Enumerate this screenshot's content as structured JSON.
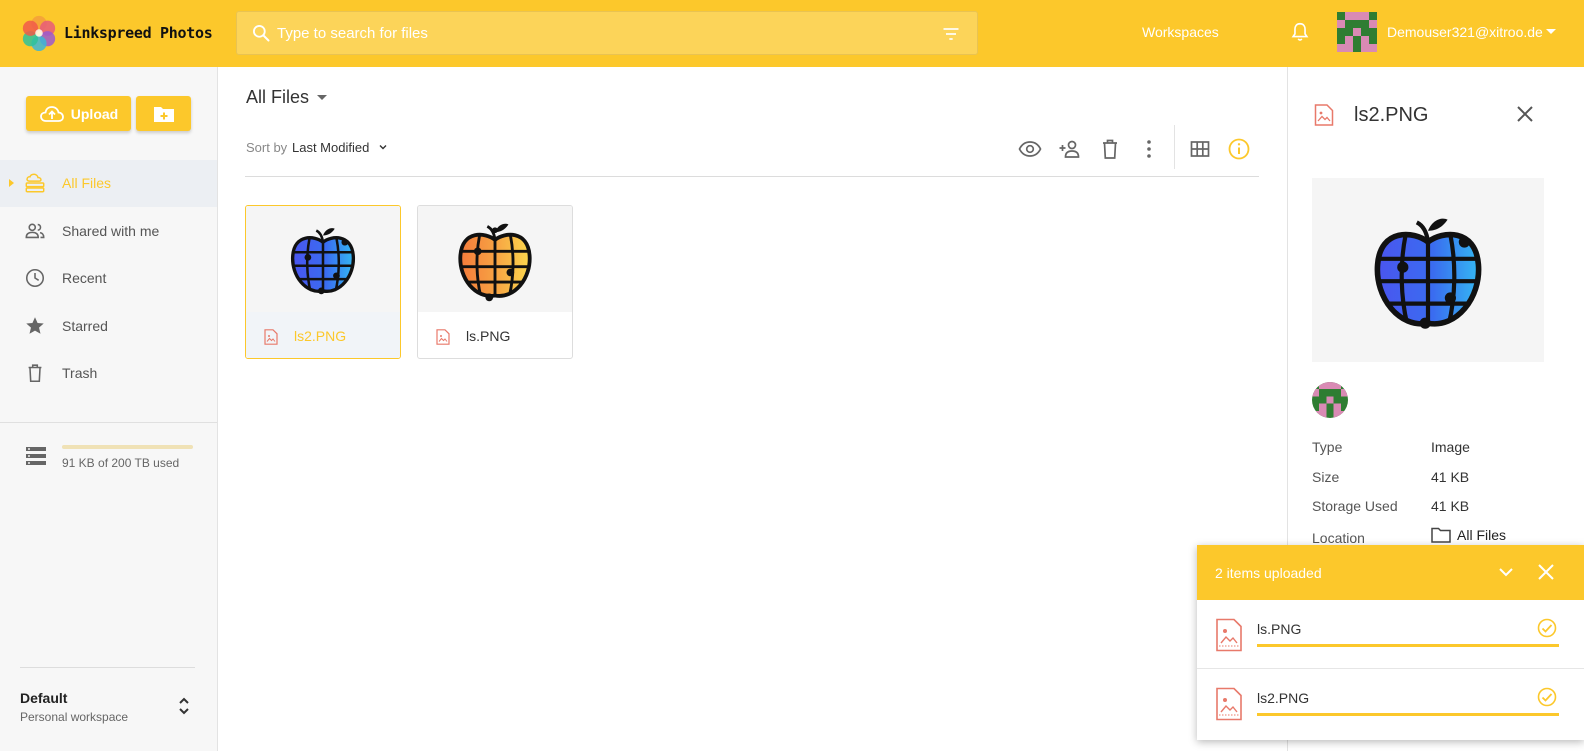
{
  "colors": {
    "accent": "#fcc82b",
    "file_icon": "#e8796a"
  },
  "header": {
    "app_name": "Linkspreed Photos",
    "search": {
      "placeholder": "Type to search for files"
    },
    "workspaces_label": "Workspaces",
    "user_email": "Demouser321@xitroo.de"
  },
  "sidebar": {
    "upload_label": "Upload",
    "nav": [
      {
        "label": "All Files",
        "icon": "cloud-stack-icon",
        "active": true
      },
      {
        "label": "Shared with me",
        "icon": "people-icon"
      },
      {
        "label": "Recent",
        "icon": "clock-icon"
      },
      {
        "label": "Starred",
        "icon": "star-icon"
      },
      {
        "label": "Trash",
        "icon": "trash-icon"
      }
    ],
    "storage": {
      "text": "91 KB of 200 TB used",
      "used_fraction": 0.0
    },
    "workspace": {
      "name": "Default",
      "type": "Personal workspace"
    }
  },
  "main": {
    "title": "All Files",
    "sort_by_label": "Sort by",
    "sort_value": "Last Modified",
    "files": [
      {
        "name": "ls2.PNG",
        "selected": true,
        "palette": "blue"
      },
      {
        "name": "ls.PNG",
        "selected": false,
        "palette": "orange"
      }
    ]
  },
  "details": {
    "title": "ls2.PNG",
    "rows": [
      {
        "label": "Type",
        "value": "Image"
      },
      {
        "label": "Size",
        "value": "41 KB"
      },
      {
        "label": "Storage Used",
        "value": "41 KB"
      }
    ],
    "location_label": "Location",
    "location_value": "All Files"
  },
  "uploads": {
    "title": "2 items uploaded",
    "items": [
      {
        "name": "ls.PNG",
        "progress": 1.0,
        "status": "done"
      },
      {
        "name": "ls2.PNG",
        "progress": 1.0,
        "status": "done"
      }
    ]
  }
}
